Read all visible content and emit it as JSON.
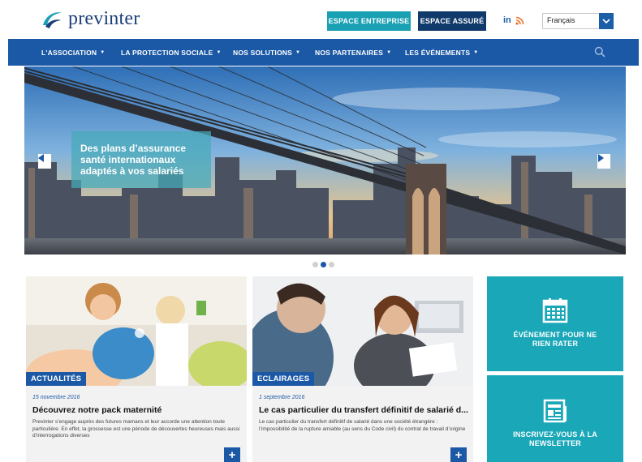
{
  "header": {
    "logo_text": "previnter",
    "espace_entreprise": "ESPACE ENTREPRISE",
    "espace_assure": "ESPACE ASSURÉ",
    "linkedin": "in",
    "language": "Français"
  },
  "nav": {
    "items": [
      {
        "label": "L'ASSOCIATION"
      },
      {
        "label": "LA PROTECTION SOCIALE"
      },
      {
        "label": "NOS SOLUTIONS"
      },
      {
        "label": "NOS PARTENAIRES"
      },
      {
        "label": "LES ÉVÉNEMENTS"
      }
    ],
    "caret": "▼"
  },
  "hero": {
    "caption": "Des plans d’assurance santé internationaux adaptés à vos salariés",
    "slides": 3,
    "active_slide": 2
  },
  "cards": [
    {
      "tag": "ACTUALITÉS",
      "date": "15 novembre 2016",
      "title": "Découvrez notre pack maternité",
      "text": "Previnter s’engage auprès des futures mamans et leur accorde une attention toute particulière. En effet, la grossesse est une période de découvertes heureuses mais aussi d’interrogations diverses",
      "plus": "+"
    },
    {
      "tag": "ECLAIRAGES",
      "date": "1 septembre 2016",
      "title": "Le cas particulier du transfert définitif de salarié d...",
      "text": "Le cas particulier du transfert définitif de salarié dans une société étrangère : l’impossibilité de la rupture amiable (au sens du Code civil) du contrat de travail d’origine",
      "plus": "+"
    }
  ],
  "tiles": [
    {
      "label_line1": "ÉVÉNEMENT POUR NE",
      "label_line2": "RIEN RATER",
      "icon": "calendar-icon"
    },
    {
      "label_line1": "INSCRIVEZ-VOUS À LA",
      "label_line2": "NEWSLETTER",
      "icon": "newsletter-icon"
    }
  ],
  "colors": {
    "nav_blue": "#1b58a5",
    "teal": "#1aa0b3",
    "dark_navy": "#0f3a6b",
    "tile_teal": "#1aa7b8"
  }
}
